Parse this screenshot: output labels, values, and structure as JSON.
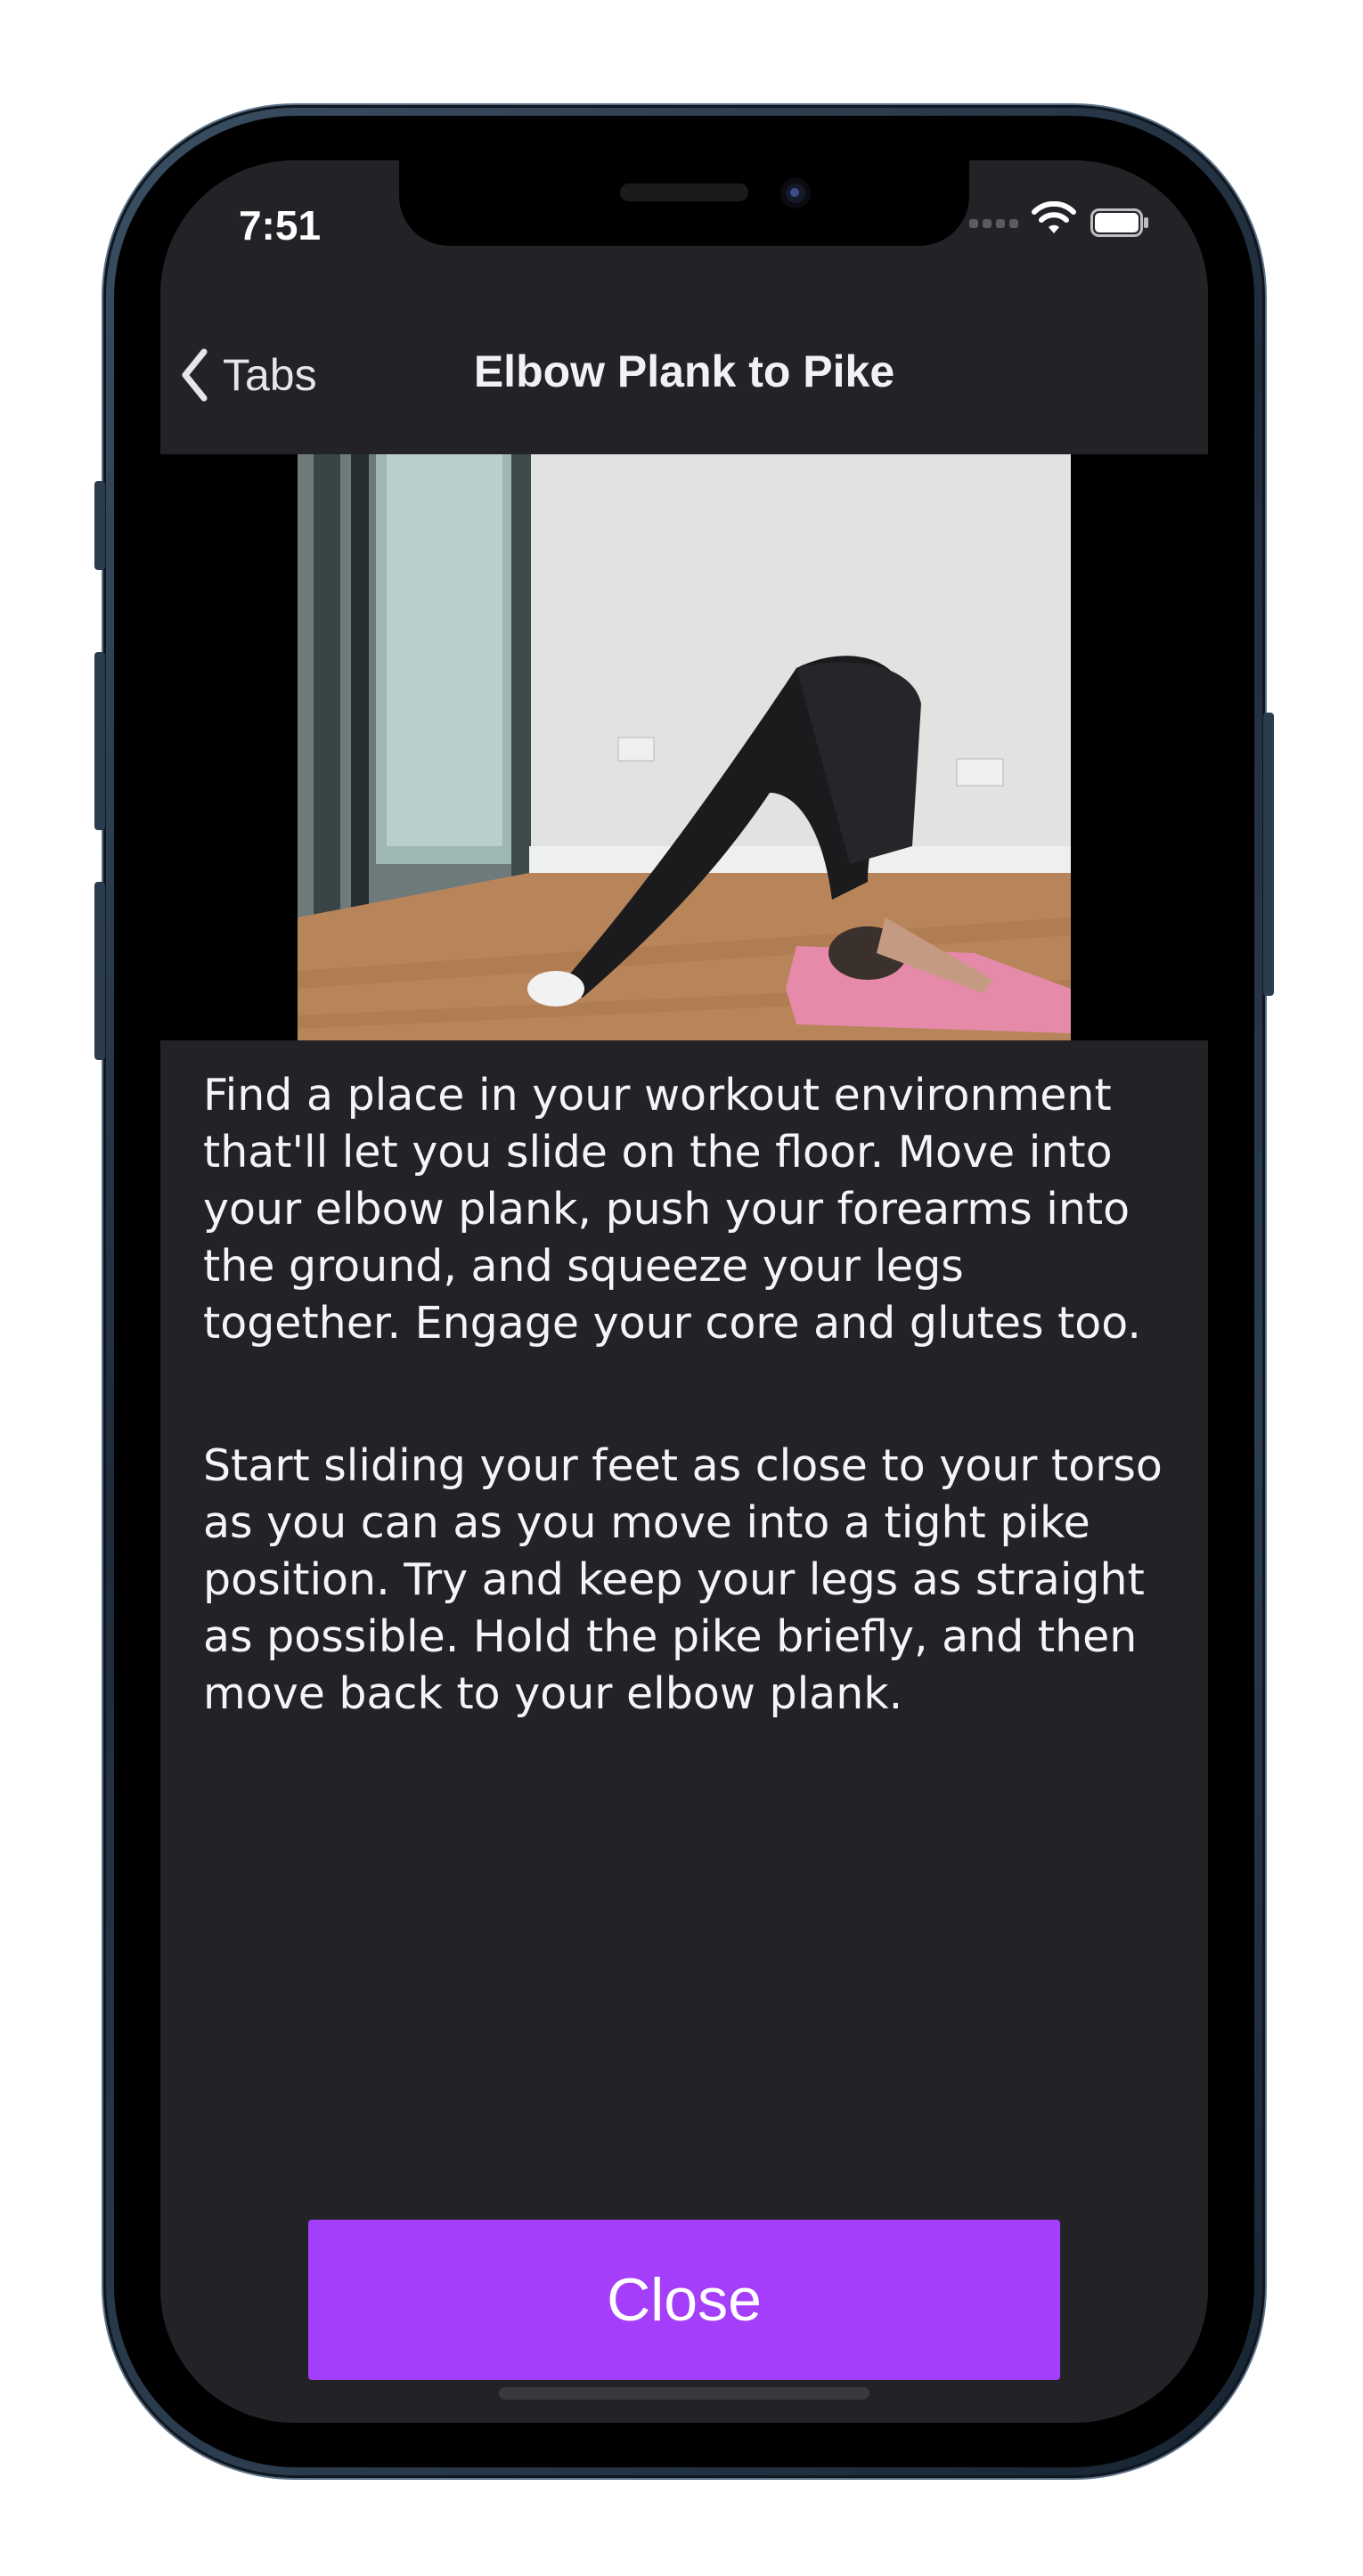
{
  "status_bar": {
    "time": "7:51",
    "icons": [
      "signal-icon",
      "wifi-icon",
      "battery-icon"
    ]
  },
  "nav": {
    "back_label": "Tabs",
    "back_icon": "chevron-left-icon",
    "title": "Elbow Plank to Pike"
  },
  "media": {
    "icon": "exercise-video"
  },
  "description": {
    "paragraphs": [
      "Find a place in your workout environment that'll let you slide on the floor. Move into your elbow plank, push your forearms into the ground, and squeeze your legs together. Engage your core and glutes too.",
      "Start sliding your feet as close to your torso as you can as you move into a tight pike position. Try and keep your legs as straight as possible. Hold the pike briefly, and then move back to your elbow plank."
    ]
  },
  "actions": {
    "close_label": "Close"
  },
  "colors": {
    "background": "#232327",
    "accent": "#a43efa",
    "text": "#f5f5f7"
  }
}
